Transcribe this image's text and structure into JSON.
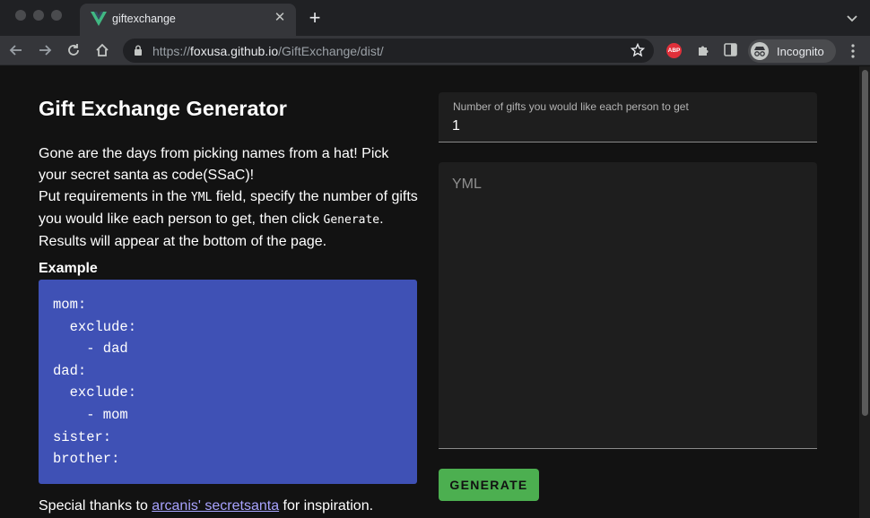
{
  "browser": {
    "tab_title": "giftexchange",
    "new_tab_icon": "plus-icon",
    "url_scheme": "https://",
    "url_host": "foxusa.github.io",
    "url_path": "/GiftExchange/dist/",
    "abp_label": "ABP",
    "incognito_label": "Incognito",
    "favicon_color": "#41b883"
  },
  "page": {
    "title": "Gift Exchange Generator",
    "intro_1": "Gone are the days from picking names from a hat! Pick your secret santa as code(SSaC)!",
    "intro_2a": "Put requirements in the ",
    "intro_2_code": "YML",
    "intro_2b": " field, specify the number of gifts you would like each person to get, then click ",
    "intro_2_code2": "Generate",
    "intro_2c": ". Results will appear at the bottom of the page.",
    "example_label": "Example",
    "example_code": "mom:\n  exclude:\n    - dad\ndad:\n  exclude:\n    - mom\nsister:\nbrother:",
    "thanks_a": "Special thanks to ",
    "thanks_link": "arcanis' secretsanta",
    "thanks_b": " for inspiration."
  },
  "form": {
    "gifts_label": "Number of gifts you would like each person to get",
    "gifts_value": "1",
    "yml_placeholder": "YML",
    "generate_label": "GENERATE"
  },
  "colors": {
    "code_bg": "#3f51b5",
    "generate_bg": "#4caf50",
    "link": "#a8a3ff"
  }
}
